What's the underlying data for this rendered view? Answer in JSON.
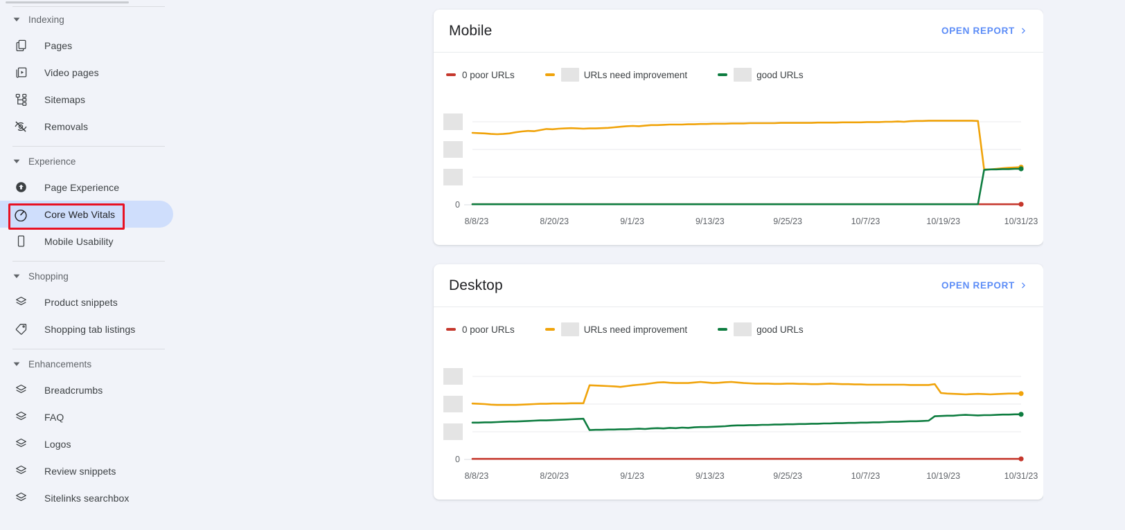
{
  "sidebar": {
    "groups": [
      {
        "name": "Indexing",
        "label": "Indexing",
        "items": [
          {
            "label": "Pages",
            "icon": "pages-icon"
          },
          {
            "label": "Video pages",
            "icon": "video-pages-icon"
          },
          {
            "label": "Sitemaps",
            "icon": "sitemaps-icon"
          },
          {
            "label": "Removals",
            "icon": "removals-icon"
          }
        ]
      },
      {
        "name": "Experience",
        "label": "Experience",
        "items": [
          {
            "label": "Page Experience",
            "icon": "page-experience-icon"
          },
          {
            "label": "Core Web Vitals",
            "icon": "core-web-vitals-icon"
          },
          {
            "label": "Mobile Usability",
            "icon": "mobile-usability-icon"
          }
        ]
      },
      {
        "name": "Shopping",
        "label": "Shopping",
        "items": [
          {
            "label": "Product snippets",
            "icon": "layers-icon"
          },
          {
            "label": "Shopping tab listings",
            "icon": "tag-icon"
          }
        ]
      },
      {
        "name": "Enhancements",
        "label": "Enhancements",
        "items": [
          {
            "label": "Breadcrumbs",
            "icon": "layers-icon"
          },
          {
            "label": "FAQ",
            "icon": "layers-icon"
          },
          {
            "label": "Logos",
            "icon": "layers-icon"
          },
          {
            "label": "Review snippets",
            "icon": "layers-icon"
          },
          {
            "label": "Sitelinks searchbox",
            "icon": "layers-icon"
          }
        ]
      }
    ],
    "selected_item": "Core Web Vitals",
    "annotation_color": "#e81123"
  },
  "colors": {
    "poor": "#c5372c",
    "needs_improvement": "#f0a30a",
    "good": "#0d7c3f",
    "link": "#5b8cf7",
    "redaction": "#e4e4e4"
  },
  "cards": [
    {
      "title": "Mobile",
      "open_report_label": "OPEN REPORT",
      "legend": [
        {
          "label": "0 poor URLs",
          "color_key": "poor",
          "redacted_value": false
        },
        {
          "label": "URLs need improvement",
          "color_key": "needs_improvement",
          "redacted_value": true
        },
        {
          "label": "good URLs",
          "color_key": "good",
          "redacted_value": true
        }
      ]
    },
    {
      "title": "Desktop",
      "open_report_label": "OPEN REPORT",
      "legend": [
        {
          "label": "0 poor URLs",
          "color_key": "poor",
          "redacted_value": false
        },
        {
          "label": "URLs need improvement",
          "color_key": "needs_improvement",
          "redacted_value": true
        },
        {
          "label": "good URLs",
          "color_key": "good",
          "redacted_value": true
        }
      ]
    }
  ],
  "chart_data": [
    {
      "type": "line",
      "title": "Mobile",
      "xlabel": "",
      "ylabel": "",
      "grid": true,
      "legend_position": "top-left",
      "x_tick_labels": [
        "8/8/23",
        "8/20/23",
        "9/1/23",
        "9/13/23",
        "9/25/23",
        "10/7/23",
        "10/19/23",
        "10/31/23"
      ],
      "y_tick_labels": [
        "",
        "",
        "",
        "0"
      ],
      "y_tick_labels_redacted": [
        true,
        true,
        true,
        false
      ],
      "ylim": [
        0,
        4
      ],
      "series": [
        {
          "name": "0 poor URLs",
          "color": "#c5372c",
          "values": [
            0.02,
            0.02,
            0.02,
            0.02,
            0.02,
            0.02,
            0.02,
            0.02,
            0.02,
            0.02,
            0.02,
            0.02,
            0.02,
            0.02,
            0.02,
            0.02,
            0.02,
            0.02,
            0.02,
            0.02,
            0.02,
            0.02,
            0.02,
            0.02,
            0.02,
            0.02,
            0.02,
            0.02,
            0.02,
            0.02,
            0.02,
            0.02,
            0.02,
            0.02,
            0.02,
            0.02,
            0.02,
            0.02,
            0.02,
            0.02,
            0.02,
            0.02,
            0.02,
            0.02,
            0.02,
            0.02,
            0.02,
            0.02,
            0.02,
            0.02,
            0.02,
            0.02,
            0.02,
            0.02,
            0.02,
            0.02,
            0.02,
            0.02,
            0.02,
            0.02,
            0.02,
            0.02,
            0.02,
            0.02,
            0.02,
            0.02,
            0.02,
            0.02,
            0.02,
            0.02,
            0.02,
            0.02,
            0.02,
            0.02,
            0.02,
            0.02,
            0.02,
            0.02,
            0.02,
            0.02,
            0.02,
            0.02,
            0.02,
            0.02,
            0.02,
            0.02,
            0.02,
            0.02,
            0.02,
            0.02
          ]
        },
        {
          "name": "URLs need improvement",
          "color": "#f0a30a",
          "values": [
            2.6,
            2.59,
            2.58,
            2.56,
            2.55,
            2.56,
            2.58,
            2.62,
            2.65,
            2.67,
            2.66,
            2.7,
            2.74,
            2.73,
            2.75,
            2.76,
            2.77,
            2.76,
            2.75,
            2.76,
            2.76,
            2.77,
            2.78,
            2.8,
            2.82,
            2.84,
            2.85,
            2.84,
            2.86,
            2.88,
            2.88,
            2.89,
            2.9,
            2.9,
            2.9,
            2.91,
            2.91,
            2.92,
            2.92,
            2.93,
            2.93,
            2.93,
            2.94,
            2.94,
            2.94,
            2.95,
            2.95,
            2.95,
            2.95,
            2.95,
            2.96,
            2.96,
            2.96,
            2.96,
            2.96,
            2.96,
            2.97,
            2.97,
            2.97,
            2.97,
            2.98,
            2.98,
            2.98,
            2.98,
            2.99,
            2.99,
            2.99,
            3.0,
            3.0,
            3.01,
            3.0,
            3.02,
            3.03,
            3.03,
            3.04,
            3.04,
            3.04,
            3.04,
            3.04,
            3.04,
            3.04,
            3.04,
            3.03,
            1.28,
            1.28,
            1.3,
            1.32,
            1.34,
            1.35,
            1.36
          ]
        },
        {
          "name": "good URLs",
          "color": "#0d7c3f",
          "values": [
            0.02,
            0.02,
            0.02,
            0.02,
            0.02,
            0.02,
            0.02,
            0.02,
            0.02,
            0.02,
            0.02,
            0.02,
            0.02,
            0.02,
            0.02,
            0.02,
            0.02,
            0.02,
            0.02,
            0.02,
            0.02,
            0.02,
            0.02,
            0.02,
            0.02,
            0.02,
            0.02,
            0.02,
            0.02,
            0.02,
            0.02,
            0.02,
            0.02,
            0.02,
            0.02,
            0.02,
            0.02,
            0.02,
            0.02,
            0.02,
            0.02,
            0.02,
            0.02,
            0.02,
            0.02,
            0.02,
            0.02,
            0.02,
            0.02,
            0.02,
            0.02,
            0.02,
            0.02,
            0.02,
            0.02,
            0.02,
            0.02,
            0.02,
            0.02,
            0.02,
            0.02,
            0.02,
            0.02,
            0.02,
            0.02,
            0.02,
            0.02,
            0.02,
            0.02,
            0.02,
            0.02,
            0.02,
            0.02,
            0.02,
            0.02,
            0.02,
            0.02,
            0.02,
            0.02,
            0.02,
            0.02,
            0.02,
            0.02,
            1.26,
            1.28,
            1.28,
            1.29,
            1.29,
            1.3,
            1.3
          ]
        }
      ]
    },
    {
      "type": "line",
      "title": "Desktop",
      "xlabel": "",
      "ylabel": "",
      "grid": true,
      "legend_position": "top-left",
      "x_tick_labels": [
        "8/8/23",
        "8/20/23",
        "9/1/23",
        "9/13/23",
        "9/25/23",
        "10/7/23",
        "10/19/23",
        "10/31/23"
      ],
      "y_tick_labels": [
        "",
        "",
        "",
        "0"
      ],
      "y_tick_labels_redacted": [
        true,
        true,
        true,
        false
      ],
      "ylim": [
        0,
        4
      ],
      "series": [
        {
          "name": "0 poor URLs",
          "color": "#c5372c",
          "values": [
            0.02,
            0.02,
            0.02,
            0.02,
            0.02,
            0.02,
            0.02,
            0.02,
            0.02,
            0.02,
            0.02,
            0.02,
            0.02,
            0.02,
            0.02,
            0.02,
            0.02,
            0.02,
            0.02,
            0.02,
            0.02,
            0.02,
            0.02,
            0.02,
            0.02,
            0.02,
            0.02,
            0.02,
            0.02,
            0.02,
            0.02,
            0.02,
            0.02,
            0.02,
            0.02,
            0.02,
            0.02,
            0.02,
            0.02,
            0.02,
            0.02,
            0.02,
            0.02,
            0.02,
            0.02,
            0.02,
            0.02,
            0.02,
            0.02,
            0.02,
            0.02,
            0.02,
            0.02,
            0.02,
            0.02,
            0.02,
            0.02,
            0.02,
            0.02,
            0.02,
            0.02,
            0.02,
            0.02,
            0.02,
            0.02,
            0.02,
            0.02,
            0.02,
            0.02,
            0.02,
            0.02,
            0.02,
            0.02,
            0.02,
            0.02,
            0.02,
            0.02,
            0.02,
            0.02,
            0.02,
            0.02,
            0.02,
            0.02,
            0.02,
            0.02,
            0.02,
            0.02,
            0.02,
            0.02,
            0.02
          ]
        },
        {
          "name": "URLs need improvement",
          "color": "#f0a30a",
          "values": [
            2.02,
            2.01,
            2.0,
            1.98,
            1.97,
            1.97,
            1.97,
            1.97,
            1.98,
            1.99,
            2.0,
            2.01,
            2.01,
            2.02,
            2.02,
            2.02,
            2.03,
            2.03,
            2.03,
            2.68,
            2.67,
            2.66,
            2.65,
            2.64,
            2.62,
            2.65,
            2.68,
            2.7,
            2.72,
            2.75,
            2.78,
            2.79,
            2.77,
            2.76,
            2.76,
            2.76,
            2.78,
            2.8,
            2.78,
            2.76,
            2.77,
            2.79,
            2.8,
            2.78,
            2.76,
            2.75,
            2.74,
            2.74,
            2.74,
            2.73,
            2.73,
            2.74,
            2.74,
            2.73,
            2.73,
            2.72,
            2.72,
            2.73,
            2.74,
            2.73,
            2.72,
            2.72,
            2.71,
            2.71,
            2.7,
            2.7,
            2.7,
            2.7,
            2.7,
            2.7,
            2.7,
            2.69,
            2.69,
            2.69,
            2.69,
            2.72,
            2.4,
            2.38,
            2.37,
            2.36,
            2.35,
            2.36,
            2.37,
            2.36,
            2.35,
            2.36,
            2.37,
            2.38,
            2.38,
            2.38
          ]
        },
        {
          "name": "good URLs",
          "color": "#0d7c3f",
          "values": [
            1.33,
            1.33,
            1.34,
            1.34,
            1.35,
            1.36,
            1.37,
            1.37,
            1.38,
            1.39,
            1.4,
            1.41,
            1.41,
            1.42,
            1.43,
            1.44,
            1.45,
            1.46,
            1.47,
            1.06,
            1.07,
            1.07,
            1.08,
            1.08,
            1.09,
            1.09,
            1.1,
            1.11,
            1.1,
            1.12,
            1.13,
            1.12,
            1.14,
            1.13,
            1.15,
            1.14,
            1.16,
            1.17,
            1.17,
            1.18,
            1.19,
            1.2,
            1.22,
            1.23,
            1.23,
            1.24,
            1.24,
            1.25,
            1.25,
            1.26,
            1.26,
            1.27,
            1.27,
            1.28,
            1.28,
            1.29,
            1.29,
            1.3,
            1.3,
            1.31,
            1.31,
            1.32,
            1.32,
            1.33,
            1.33,
            1.34,
            1.34,
            1.35,
            1.36,
            1.36,
            1.37,
            1.38,
            1.38,
            1.39,
            1.4,
            1.56,
            1.57,
            1.58,
            1.58,
            1.6,
            1.61,
            1.6,
            1.59,
            1.6,
            1.6,
            1.61,
            1.62,
            1.62,
            1.63,
            1.63
          ]
        }
      ]
    }
  ]
}
